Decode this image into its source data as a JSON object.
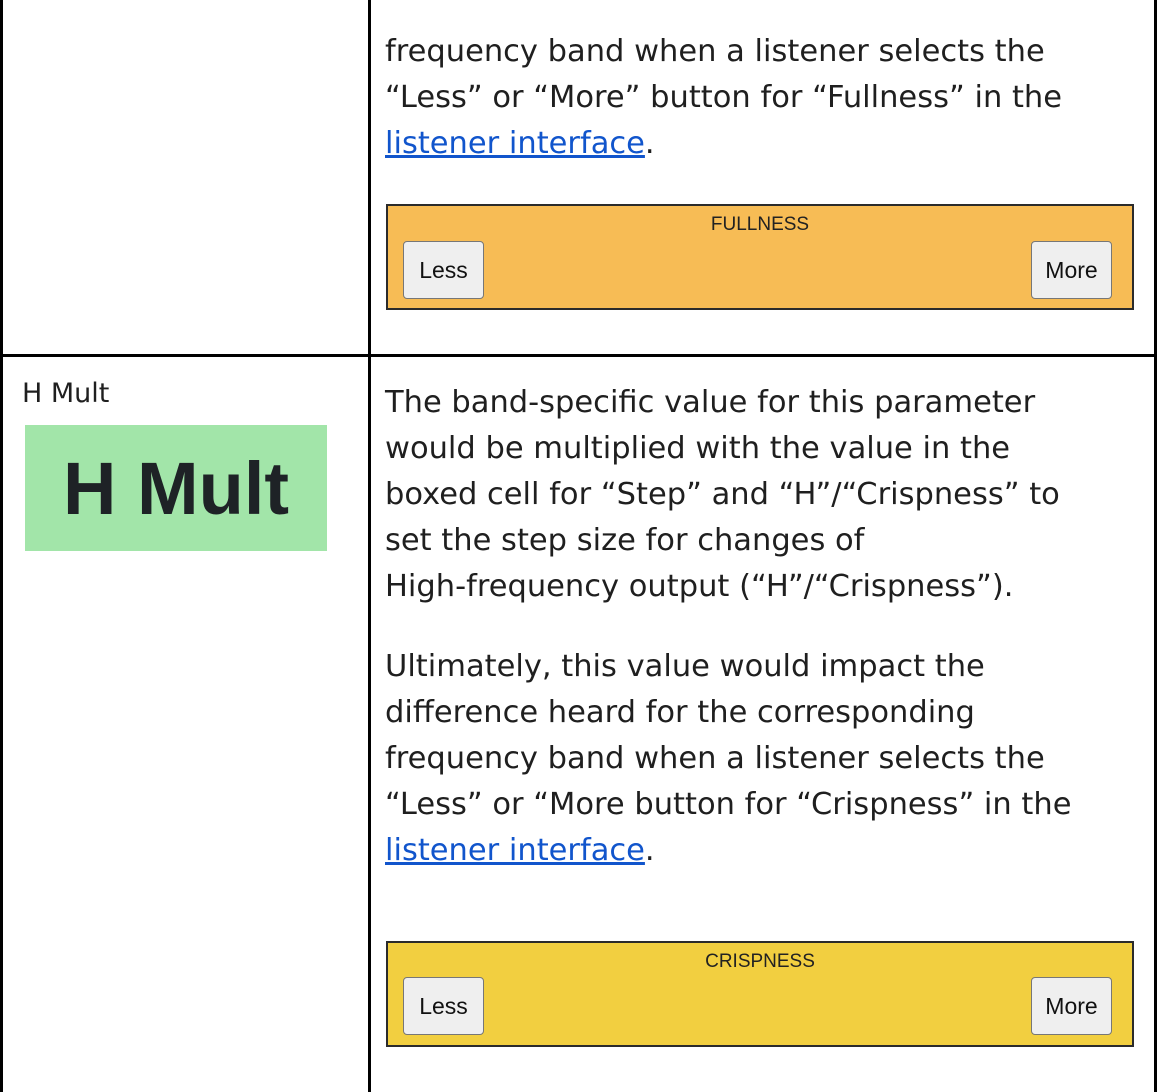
{
  "row1": {
    "description_lines": [
      "frequency band when a listener selects the",
      "“Less” or “More” button for “Fullness” in the"
    ],
    "link_text": "listener interface",
    "link_suffix": ".",
    "widget": {
      "title": "FULLNESS",
      "less_label": "Less",
      "more_label": "More",
      "color": "#f7bc55"
    }
  },
  "row2": {
    "param_label": "H Mult",
    "param_image_text": "H Mult",
    "param_image_color": "#a2e5a9",
    "paragraph1_lines": [
      "The band-specific value for this parameter",
      "would be multiplied with the value in the",
      "boxed cell for “Step” and “H”/“Crispness” to",
      "set the step size for changes of",
      "High-frequency output (“H”/“Crispness”)."
    ],
    "paragraph2_lines": [
      "Ultimately, this value would impact the",
      "difference heard for the corresponding",
      "frequency band when a listener selects the",
      "“Less” or “More button for “Crispness” in the"
    ],
    "link_text": "listener interface",
    "link_suffix": ".",
    "widget": {
      "title": "CRISPNESS",
      "less_label": "Less",
      "more_label": "More",
      "color": "#f2cf40"
    }
  },
  "colors": {
    "link": "#1155cc",
    "text": "#1f1f1f",
    "grid": "#000000"
  }
}
